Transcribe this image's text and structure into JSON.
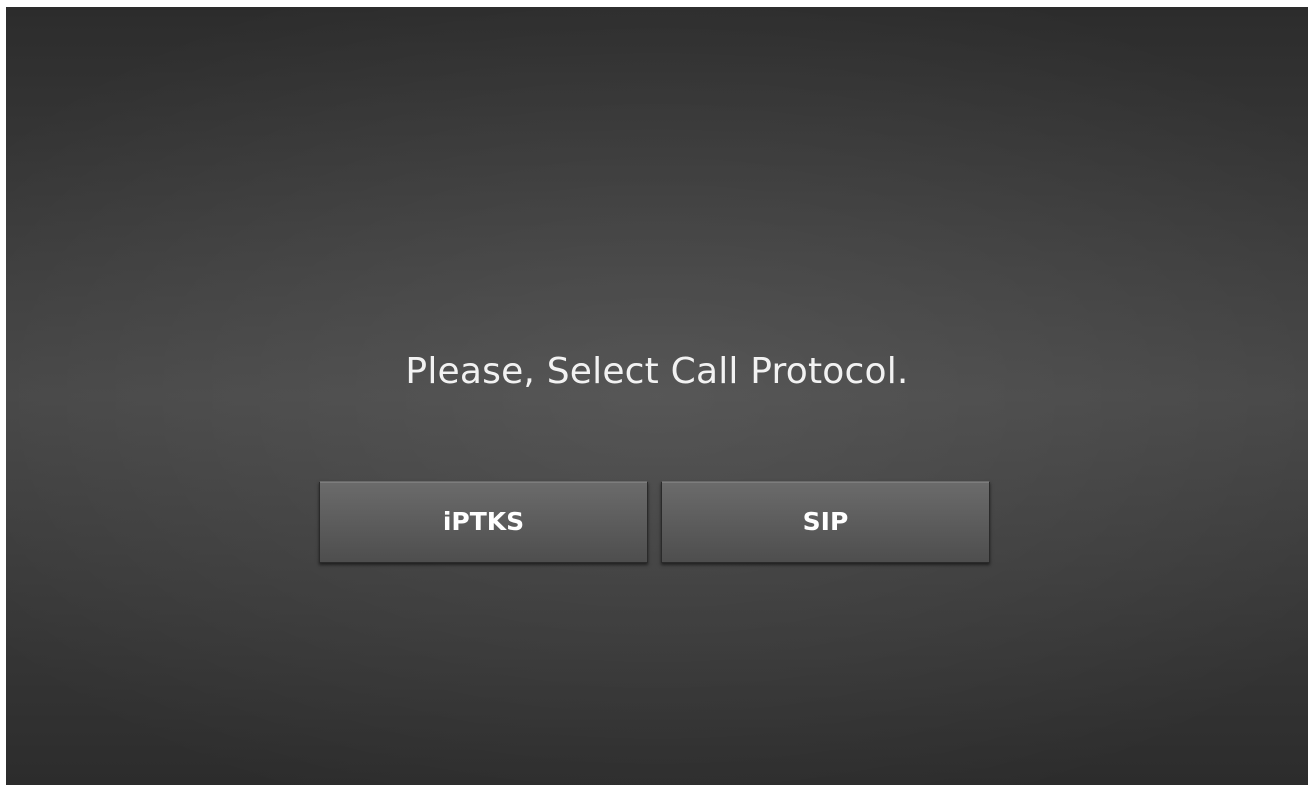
{
  "prompt": {
    "text": "Please, Select Call Protocol."
  },
  "buttons": {
    "iptks_label": "iPTKS",
    "sip_label": "SIP"
  },
  "colors": {
    "background_dark": "#2c2c2c",
    "background_mid": "#464646",
    "button_top": "#6b6b6b",
    "button_bottom": "#4e4e4e",
    "text": "#f2f2f2"
  }
}
